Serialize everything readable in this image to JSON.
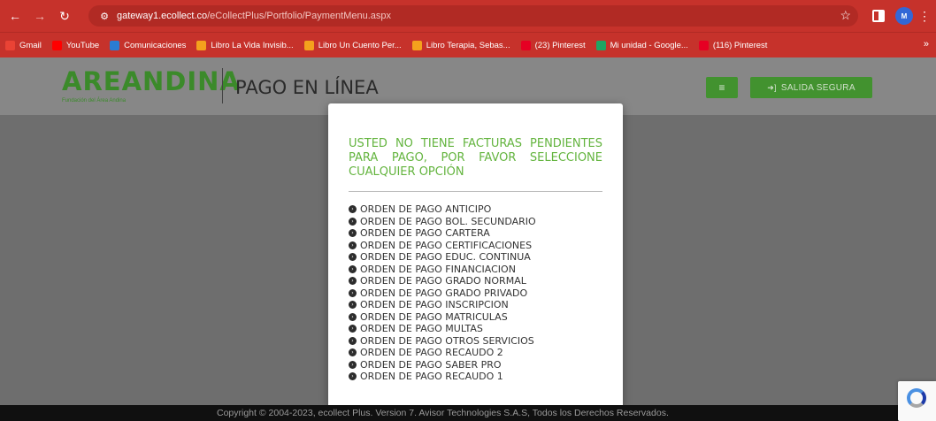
{
  "browser": {
    "url_host": "gateway1.ecollect.co",
    "url_path": "/eCollectPlus/Portfolio/PaymentMenu.aspx",
    "bookmarks": [
      {
        "label": "Gmail",
        "icon": "gmail-icon",
        "color": "#ea4335"
      },
      {
        "label": "YouTube",
        "icon": "youtube-icon",
        "color": "#ff0000"
      },
      {
        "label": "Comunicaciones",
        "icon": "outlook-icon",
        "color": "#2b7cd3"
      },
      {
        "label": "Libro La Vida Invisib...",
        "icon": "book-icon",
        "color": "#f4a11d"
      },
      {
        "label": "Libro Un Cuento Per...",
        "icon": "book-icon",
        "color": "#f4a11d"
      },
      {
        "label": "Libro Terapia, Sebas...",
        "icon": "book-icon",
        "color": "#f4a11d"
      },
      {
        "label": "(23) Pinterest",
        "icon": "pinterest-icon",
        "color": "#e60023"
      },
      {
        "label": "Mi unidad - Google...",
        "icon": "drive-icon",
        "color": "#1fa463"
      },
      {
        "label": "(116) Pinterest",
        "icon": "pinterest-icon",
        "color": "#e60023"
      }
    ],
    "more_label": "»"
  },
  "header": {
    "logo_text": "AREANDINA",
    "logo_subtitle": "Fundación del Área Andina",
    "title": "PAGO EN LÍNEA",
    "menu_label": "≡",
    "exit_label": "SALIDA SEGURA"
  },
  "modal": {
    "message": "USTED NO TIENE FACTURAS PENDIENTES PARA PAGO, POR FAVOR SELECCIONE CUALQUIER OPCIÓN",
    "orders": [
      "ORDEN DE PAGO ANTICIPO",
      "ORDEN DE PAGO BOL. SECUNDARIO",
      "ORDEN DE PAGO CARTERA",
      "ORDEN DE PAGO CERTIFICACIONES",
      "ORDEN DE PAGO EDUC. CONTINUA",
      "ORDEN DE PAGO FINANCIACION",
      "ORDEN DE PAGO GRADO NORMAL",
      "ORDEN DE PAGO GRADO PRIVADO",
      "ORDEN DE PAGO INSCRIPCION",
      "ORDEN DE PAGO MATRICULAS",
      "ORDEN DE PAGO MULTAS",
      "ORDEN DE PAGO OTROS SERVICIOS",
      "ORDEN DE PAGO RECAUDO 2",
      "ORDEN DE PAGO SABER PRO",
      "ORDEN DE PAGO RECAUDO 1"
    ]
  },
  "footer": {
    "text": "Copyright © 2004-2023, ecollect Plus. Version 7. Avisor Technologies S.A.S, Todos los Derechos Reservados."
  },
  "colors": {
    "chrome_red": "#c6322b",
    "brand_green": "#42922f",
    "message_green": "#63b43e"
  }
}
